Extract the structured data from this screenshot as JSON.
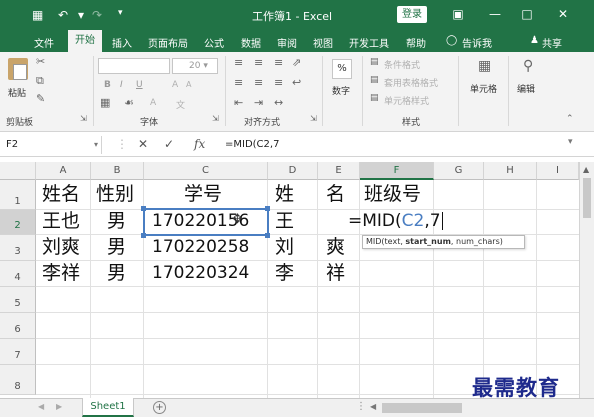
{
  "window": {
    "title": "工作簿1 - Excel",
    "login_label": "登录"
  },
  "menu": {
    "items": [
      "文件",
      "开始",
      "插入",
      "页面布局",
      "公式",
      "数据",
      "审阅",
      "视图",
      "开发工具",
      "帮助"
    ],
    "active": "开始",
    "tell_me": "告诉我",
    "share": "共享"
  },
  "ribbon": {
    "clipboard": {
      "paste": "粘贴",
      "group_label": "剪贴板"
    },
    "font": {
      "size": "20",
      "bold": "B",
      "italic": "I",
      "underline": "U",
      "grow": "A",
      "shrink": "A",
      "font_color": "A",
      "phonetic": "文",
      "group_label": "字体"
    },
    "alignment": {
      "group_label": "对齐方式"
    },
    "number": {
      "symbol": "%",
      "label": "数字"
    },
    "styles": {
      "conditional": "条件格式",
      "table": "套用表格格式",
      "cell": "单元格样式",
      "group_label": "样式"
    },
    "cells": {
      "label": "单元格"
    },
    "editing": {
      "label": "编辑"
    }
  },
  "formula_bar": {
    "name_box": "F2",
    "cancel": "✕",
    "enter": "✓",
    "fx": "fx",
    "formula": "=MID(C2,7"
  },
  "columns": [
    "A",
    "B",
    "C",
    "D",
    "E",
    "F",
    "G",
    "H",
    "I"
  ],
  "rows": [
    "1",
    "2",
    "3",
    "4",
    "5",
    "6",
    "7",
    "8"
  ],
  "cells": {
    "A1": "姓名",
    "B1": "性别",
    "C1": "学号",
    "D1": "姓",
    "E1": "名",
    "F1": "班级号",
    "A2": "王也",
    "B2": "男",
    "C2": "170220156",
    "D2": "王",
    "E2": "",
    "A3": "刘爽",
    "B3": "男",
    "C3": "170220258",
    "D3": "刘",
    "E3": "爽",
    "A4": "李祥",
    "B4": "男",
    "C4": "170220324",
    "D4": "李",
    "E4": "祥"
  },
  "edit_cell": {
    "prefix": "=MID(",
    "ref": "C2",
    "suffix": ",7"
  },
  "tooltip": {
    "fn": "MID(text, ",
    "current_arg": "start_num",
    "rest": ", num_chars)"
  },
  "sheets": {
    "active": "Sheet1",
    "add": "+"
  },
  "watermark": "最需教育",
  "colors": {
    "excel_green": "#217346",
    "reference_blue": "#4a7ec2"
  }
}
